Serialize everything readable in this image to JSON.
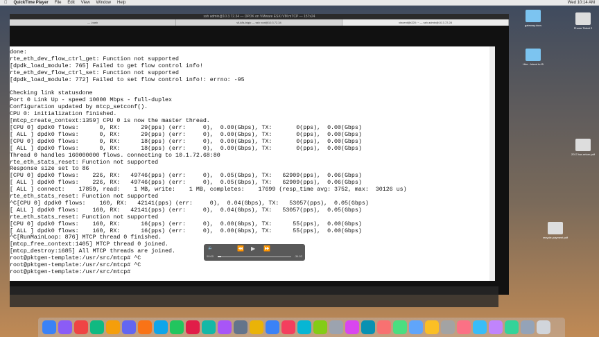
{
  "menubar": {
    "app": "QuickTime Player",
    "items": [
      "File",
      "Edit",
      "View",
      "Window",
      "Help"
    ],
    "clock": "Wed 10:14 AM"
  },
  "window": {
    "title": "ssh admin@10.3.72.34 — DPDK on VMware ESXi VM mTCP — 157x24"
  },
  "tabs": [
    {
      "label": "— -bash"
    },
    {
      "label": "vll-k8s-bigip — ssh root@10.3.72.34"
    },
    {
      "label": "vincent@r220: ~ — ssh admin@10.3.72.28"
    }
  ],
  "terminal": {
    "lines": [
      "done:",
      "rte_eth_dev_flow_ctrl_get: Function not supported",
      "[dpdk_load_module: 765] Failed to get flow control info!",
      "rte_eth_dev_flow_ctrl_set: Function not supported",
      "[dpdk_load_module: 772] Failed to set flow control info!: errno: -95",
      "",
      "Checking link statusdone",
      "Port 0 Link Up - speed 10000 Mbps - full-duplex",
      "Configuration updated by mtcp_setconf().",
      "CPU 0: initialization finished.",
      "[mtcp_create_context:1359] CPU 0 is now the master thread.",
      "[CPU 0] dpdk0 flows:      0, RX:      29(pps) (err:     0),  0.00(Gbps), TX:       0(pps),  0.00(Gbps)",
      "[ ALL ] dpdk0 flows:      0, RX:      29(pps) (err:     0),  0.00(Gbps), TX:       0(pps),  0.00(Gbps)",
      "[CPU 0] dpdk0 flows:      0, RX:      18(pps) (err:     0),  0.00(Gbps), TX:       0(pps),  0.00(Gbps)",
      "[ ALL ] dpdk0 flows:      0, RX:      18(pps) (err:     0),  0.00(Gbps), TX:       0(pps),  0.00(Gbps)",
      "Thread 0 handles 160000000 flows. connecting to 10.1.72.68:80",
      "rte_eth_stats_reset: Function not supported",
      "Response size set to 86",
      "[CPU 0] dpdk0 flows:    226, RX:   49746(pps) (err:     0),  0.05(Gbps), TX:   62909(pps),  0.06(Gbps)",
      "[ ALL ] dpdk0 flows:    226, RX:   49746(pps) (err:     0),  0.05(Gbps), TX:   62909(pps),  0.06(Gbps)",
      "[ ALL ] connect:    17859, read:    1 MB, write:    1 MB, completes:    17699 (resp_time avg: 3752, max:  30126 us)",
      "rte_eth_stats_reset: Function not supported",
      "^C[CPU 0] dpdk0 flows:    160, RX:   42141(pps) (err:     0),  0.04(Gbps), TX:   53057(pps),  0.05(Gbps)",
      "[ ALL ] dpdk0 flows:    160, RX:   42141(pps) (err:     0),  0.04(Gbps), TX:   53057(pps),  0.05(Gbps)",
      "rte_eth_stats_reset: Function not supported",
      "[CPU 0] dpdk0 flows:    160, RX:      16(pps) (err:     0),  0.00(Gbps), TX:      55(pps),  0.00(Gbps)",
      "[ ALL ] dpdk0 flows:    160, RX:      16(pps) (err:     0),  0.00(Gbps), TX:      55(pps),  0.00(Gbps)",
      "^C[RunMainLoop: 876] MTCP thread 0 finished.",
      "[mtcp_free_context:1405] MTCP thread 0 joined.",
      "[mtcp_destroy:1685] All MTCP threads are joined.",
      "root@pktgen-template:/usr/src/mtcp# ^C",
      "root@pktgen-template:/usr/src/mtcp# ^C",
      "root@pktgen-template:/usr/src/mtcp# "
    ]
  },
  "player": {
    "time_elapsed": "00:00",
    "time_remaining": "-34:02",
    "progress": 0.05
  },
  "desktop_icons": [
    {
      "label": "gateway.docs"
    },
    {
      "label": "Phone Ticket 2"
    },
    {
      "label": "Hire - Intent to f5"
    },
    {
      "label": "2017-tax-return.pdf"
    },
    {
      "label": "recycle-payment.pdf"
    }
  ]
}
